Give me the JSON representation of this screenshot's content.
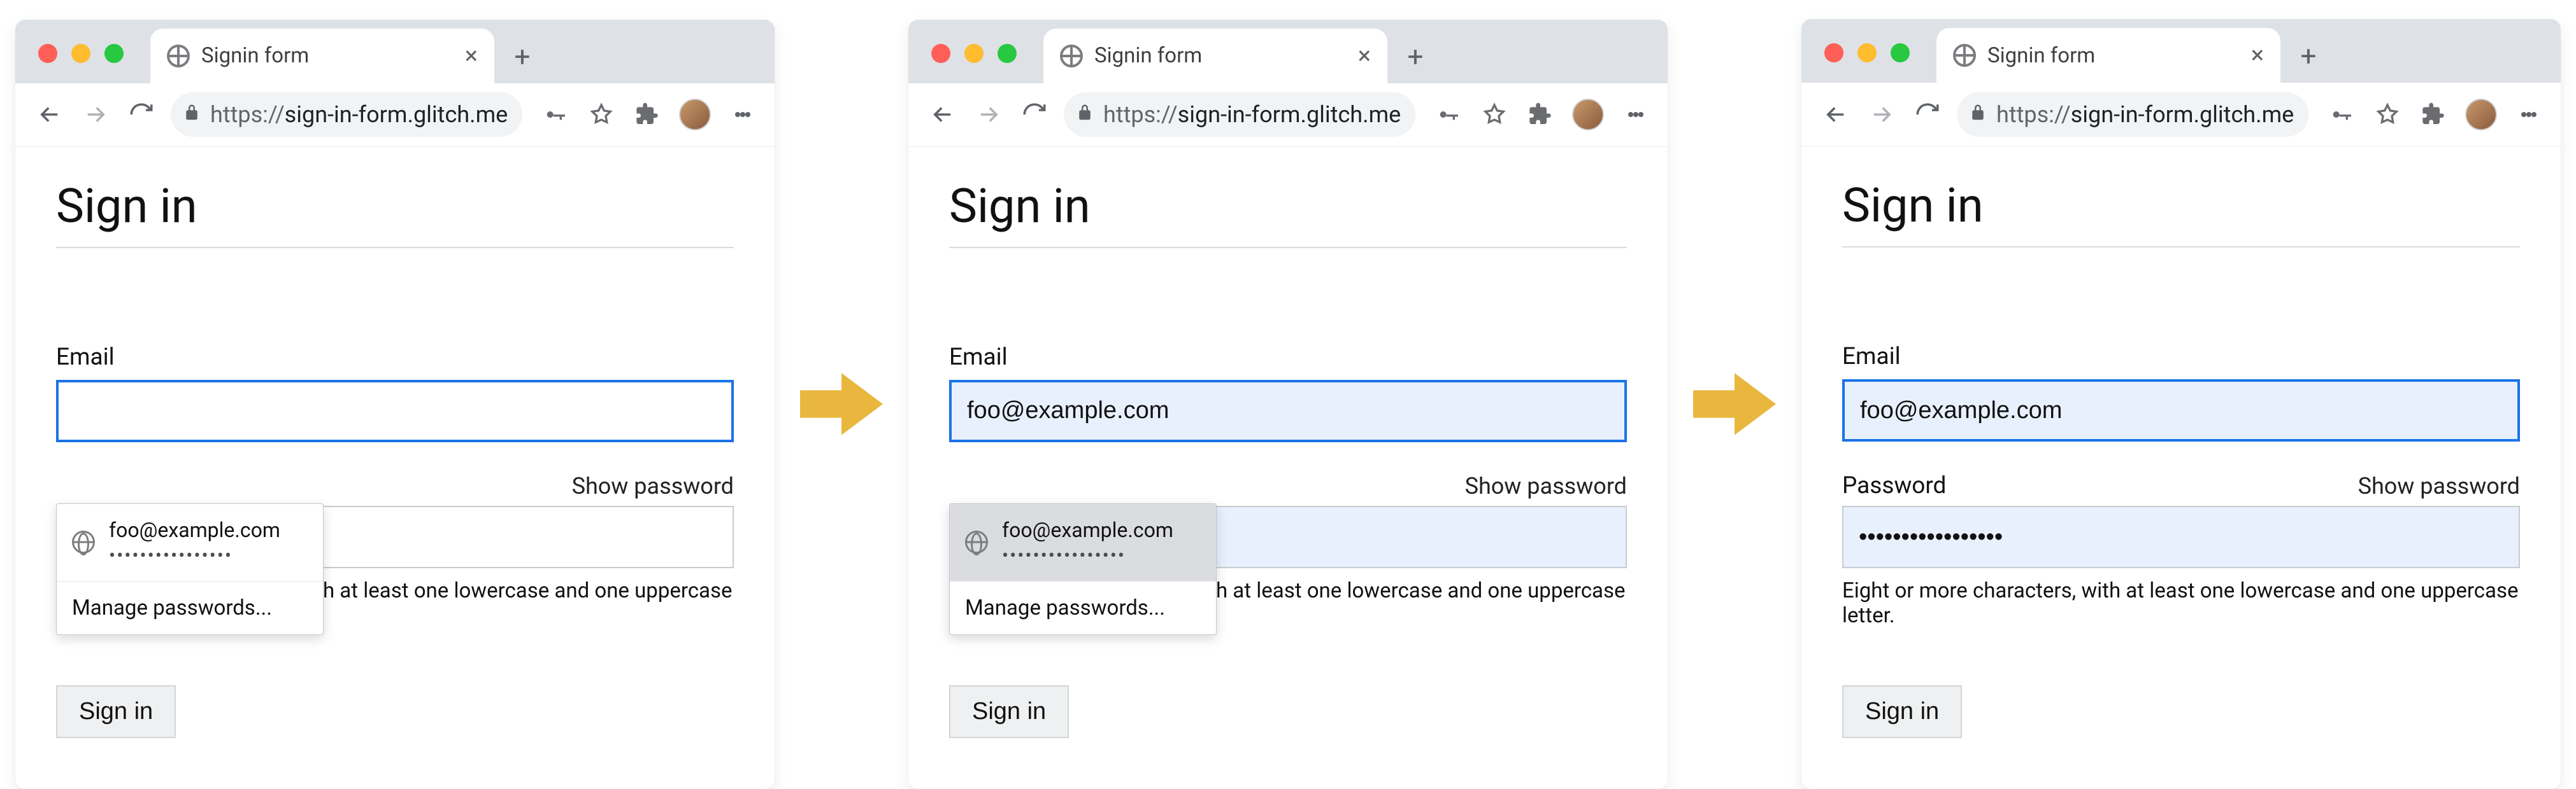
{
  "browser": {
    "tab_title": "Signin form",
    "url_scheme": "https://",
    "url_host": "sign-in-form.glitch.me"
  },
  "form": {
    "heading": "Sign in",
    "email_label": "Email",
    "password_label": "Password",
    "show_password": "Show password",
    "hint": "Eight or more characters, with at least one lowercase and one uppercase letter.",
    "submit": "Sign in"
  },
  "autofill": {
    "email": "foo@example.com",
    "password_dots": "••••••••••••••••",
    "manage": "Manage passwords..."
  },
  "values": {
    "filled_email": "foo@example.com",
    "filled_password": "•••••••••••••••••"
  }
}
